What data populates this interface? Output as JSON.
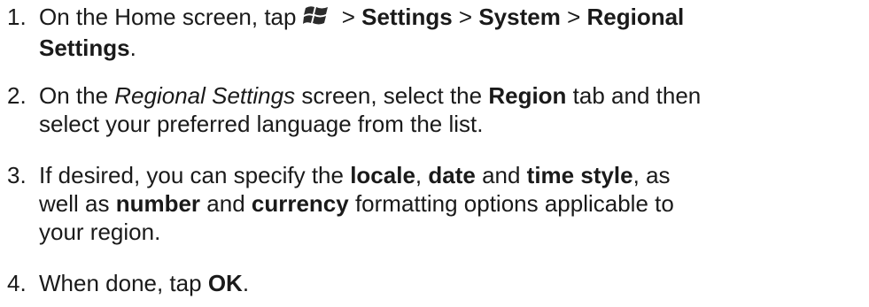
{
  "steps": [
    {
      "number": "1.",
      "text_a": "On the Home screen, tap",
      "sep1": " > ",
      "settings": "Settings",
      "sep2": " > ",
      "system": "System",
      "sep3": " > ",
      "regional_line1": "Regional",
      "regional_line2": "Settings",
      "end": ".",
      "icon": "windows-start-icon"
    },
    {
      "number": "2.",
      "text_a": "On the ",
      "screen_name": "Regional Settings",
      "text_b": " screen, select the ",
      "region": "Region",
      "text_c": " tab and then",
      "line2": "select your preferred language from the list."
    },
    {
      "number": "3.",
      "text_a": "If desired, you can specify the ",
      "locale": "locale",
      "comma1": ", ",
      "date": "date",
      "and1": " and ",
      "time_style": "time style",
      "text_b": ", as",
      "line2_a": "well as ",
      "number_word": "number",
      "and2": " and ",
      "currency": "currency",
      "line2_b": " formatting options applicable to",
      "line3": "your region."
    },
    {
      "number": "4.",
      "text_a": "When done, tap ",
      "ok": "OK",
      "end": "."
    }
  ]
}
